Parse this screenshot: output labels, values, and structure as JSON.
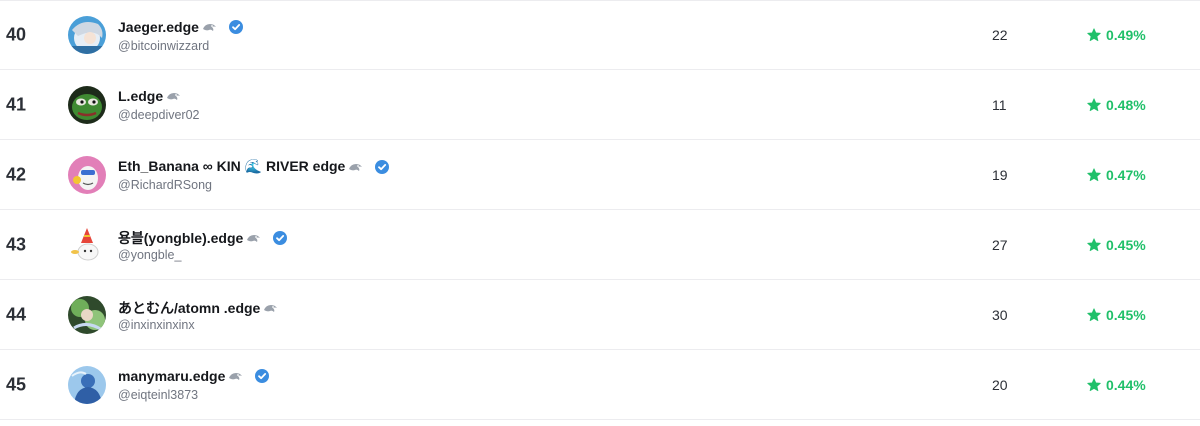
{
  "colors": {
    "accent_green": "#21c06a",
    "verified_blue": "#3b8de0",
    "row_divider": "#ececef"
  },
  "leaderboard": {
    "rows": [
      {
        "rank": "40",
        "name": "Jaeger.edge",
        "handle": "@bitcoinwizzard",
        "count": "22",
        "score": "0.49%",
        "verified": true,
        "avatar": "anime-girl-avatar"
      },
      {
        "rank": "41",
        "name": "L.edge",
        "handle": "@deepdiver02",
        "count": "11",
        "score": "0.48%",
        "verified": false,
        "avatar": "pepe-frog-avatar"
      },
      {
        "rank": "42",
        "name": "Eth_Banana ∞ KIN 🌊 RIVER edge",
        "handle": "@RichardRSong",
        "count": "19",
        "score": "0.47%",
        "verified": true,
        "avatar": "pink-cartoon-avatar"
      },
      {
        "rank": "43",
        "name": "용블(yongble).edge",
        "handle": "@yongble_",
        "count": "27",
        "score": "0.45%",
        "verified": true,
        "avatar": "party-hat-avatar"
      },
      {
        "rank": "44",
        "name": "あとむん/atomn .edge",
        "handle": "@inxinxinxinx",
        "count": "30",
        "score": "0.45%",
        "verified": false,
        "avatar": "green-art-avatar"
      },
      {
        "rank": "45",
        "name": "manymaru.edge",
        "handle": "@eiqteinl3873",
        "count": "20",
        "score": "0.44%",
        "verified": true,
        "avatar": "blue-silhouette-avatar"
      }
    ]
  }
}
